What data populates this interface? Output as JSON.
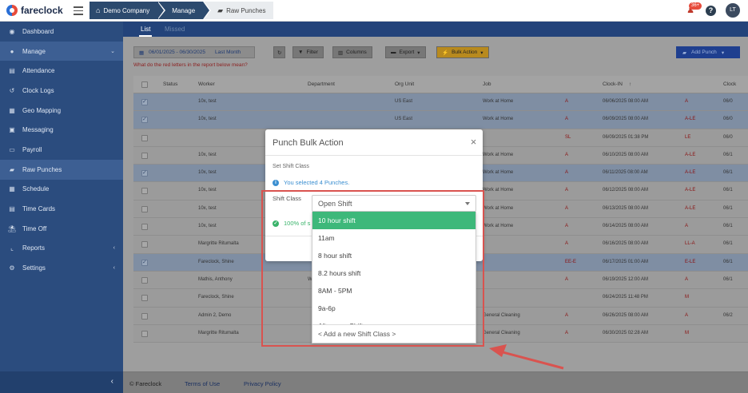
{
  "app": {
    "name": "fareclock"
  },
  "breadcrumbs": [
    "Demo Company",
    "Manage",
    "Raw Punches"
  ],
  "notifications": {
    "count": "36+"
  },
  "user": {
    "initials": "LT"
  },
  "sidebar": {
    "items": [
      {
        "label": "Dashboard",
        "icon": "dashboard-icon",
        "glyph": "◉"
      },
      {
        "label": "Manage",
        "icon": "user-icon",
        "glyph": "●"
      },
      {
        "label": "Attendance",
        "icon": "attendance-icon",
        "glyph": "▤"
      },
      {
        "label": "Clock Logs",
        "icon": "history-icon",
        "glyph": "↺"
      },
      {
        "label": "Geo Mapping",
        "icon": "map-icon",
        "glyph": "▦"
      },
      {
        "label": "Messaging",
        "icon": "message-icon",
        "glyph": "▣"
      },
      {
        "label": "Payroll",
        "icon": "payroll-icon",
        "glyph": "▭"
      },
      {
        "label": "Raw Punches",
        "icon": "car-icon",
        "glyph": "▰"
      },
      {
        "label": "Schedule",
        "icon": "calendar-icon",
        "glyph": "▦"
      },
      {
        "label": "Time Cards",
        "icon": "timecard-icon",
        "glyph": "▤"
      },
      {
        "label": "Time Off",
        "icon": "timeoff-icon",
        "glyph": "⛱"
      },
      {
        "label": "Reports",
        "icon": "chart-icon",
        "glyph": "⌞"
      },
      {
        "label": "Settings",
        "icon": "gear-icon",
        "glyph": "⚙"
      }
    ]
  },
  "tabs": {
    "list": "List",
    "missed": "Missed"
  },
  "toolbar": {
    "date_range": "06/01/2025 - 06/30/2025",
    "period": "Last Month",
    "filter": "Filter",
    "columns": "Columns",
    "export": "Export",
    "bulk_action": "Bulk Action",
    "add_punch": "Add Punch",
    "red_letters_help": "What do the red letters in the report below mean?"
  },
  "table": {
    "headers": [
      "Status",
      "Worker",
      "Department",
      "Org Unit",
      "Job",
      "Clock-IN",
      "Clock"
    ],
    "rows": [
      {
        "selected": true,
        "worker": "10x, test",
        "dept": "",
        "org": "US East",
        "job": "Work at Home",
        "flag": "A",
        "clockin": "06/06/2025 08:00 AM",
        "flag2": "A",
        "clock": "06/0"
      },
      {
        "selected": true,
        "worker": "10x, test",
        "dept": "",
        "org": "US East",
        "job": "Work at Home",
        "flag": "A",
        "clockin": "06/09/2025 08:00 AM",
        "flag2": "A-LE",
        "clock": "06/0"
      },
      {
        "selected": false,
        "worker": "",
        "dept": "",
        "org": "",
        "job": "",
        "flag": "SL",
        "clockin": "06/09/2025 01:38 PM",
        "flag2": "LE",
        "clock": "06/0"
      },
      {
        "selected": false,
        "worker": "10x, test",
        "dept": "",
        "org": "",
        "job": "Work at Home",
        "flag": "A",
        "clockin": "06/10/2025 08:00 AM",
        "flag2": "A-LE",
        "clock": "06/1"
      },
      {
        "selected": true,
        "worker": "10x, test",
        "dept": "",
        "org": "",
        "job": "Work at Home",
        "flag": "A",
        "clockin": "06/11/2025 08:00 AM",
        "flag2": "A-LE",
        "clock": "06/1"
      },
      {
        "selected": false,
        "worker": "10x, test",
        "dept": "",
        "org": "",
        "job": "Work at Home",
        "flag": "A",
        "clockin": "06/12/2025 08:00 AM",
        "flag2": "A-LE",
        "clock": "06/1"
      },
      {
        "selected": false,
        "worker": "10x, test",
        "dept": "",
        "org": "",
        "job": "Work at Home",
        "flag": "A",
        "clockin": "06/13/2025 08:00 AM",
        "flag2": "A-LE",
        "clock": "06/1"
      },
      {
        "selected": false,
        "worker": "10x, test",
        "dept": "",
        "org": "",
        "job": "Work at Home",
        "flag": "A",
        "clockin": "06/14/2025 08:00 AM",
        "flag2": "A",
        "clock": "06/1"
      },
      {
        "selected": false,
        "worker": "Margritte Ritumalta",
        "dept": "",
        "org": "",
        "job": "",
        "flag": "A",
        "clockin": "06/16/2025 08:00 AM",
        "flag2": "LL-A",
        "clock": "06/1"
      },
      {
        "selected": true,
        "worker": "Fareclock, Shine",
        "dept": "",
        "org": "",
        "job": "",
        "flag": "EE-E",
        "clockin": "06/17/2025 01:00 AM",
        "flag2": "E-LE",
        "clock": "06/1"
      },
      {
        "selected": false,
        "worker": "Mathis, Anthony",
        "dept": "W",
        "org": "",
        "job": "",
        "flag": "A",
        "clockin": "06/19/2025 12:00 AM",
        "flag2": "A",
        "clock": "06/1"
      },
      {
        "selected": false,
        "worker": "Fareclock, Shine",
        "dept": "",
        "org": "",
        "job": "",
        "flag": "",
        "clockin": "06/24/2025 11:48 PM",
        "flag2": "M",
        "clock": ""
      },
      {
        "selected": false,
        "worker": "Admin 2, Demo",
        "dept": "",
        "org": "",
        "job": "General Cleaning",
        "flag": "A",
        "clockin": "06/26/2025 08:00 AM",
        "flag2": "A",
        "clock": "06/2"
      },
      {
        "selected": false,
        "worker": "Margritte Ritumalta",
        "dept": "",
        "org": "",
        "job": "General Cleaning",
        "flag": "A",
        "clockin": "06/30/2025 02:28 AM",
        "flag2": "M",
        "clock": ""
      }
    ]
  },
  "footer": {
    "copyright": "© Fareclock",
    "terms": "Terms of Use",
    "privacy": "Privacy Policy"
  },
  "modal": {
    "title": "Punch Bulk Action",
    "section_label": "Set Shift Class",
    "info": "You selected 4 Punches.",
    "field_label": "Shift Class",
    "success": "100% of s"
  },
  "select": {
    "value": "Open Shift",
    "options": [
      "10 hour shift",
      "11am",
      "8 hour shift",
      "8.2 hours shift",
      "8AM - 5PM",
      "9a-6p",
      "Afternoon Shift"
    ],
    "highlighted": "10 hour shift",
    "add_new": "< Add a new Shift Class >"
  },
  "colors": {
    "sidebar": "#2b4c7e",
    "highlight": "#3db87a",
    "annotation": "#d9534f"
  }
}
